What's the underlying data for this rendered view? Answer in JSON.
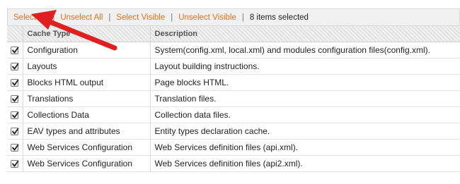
{
  "massaction": {
    "select_all": "Select All",
    "unselect_all": "Unselect All",
    "select_visible": "Select Visible",
    "unselect_visible": "Unselect Visible",
    "separator": "|",
    "selected_count": "8 items selected"
  },
  "grid": {
    "headers": {
      "cache_type": "Cache Type",
      "description": "Description"
    },
    "rows": [
      {
        "cache_type": "Configuration",
        "description": "System(config.xml, local.xml) and modules configuration files(config.xml).",
        "checked": true
      },
      {
        "cache_type": "Layouts",
        "description": "Layout building instructions.",
        "checked": true
      },
      {
        "cache_type": "Blocks HTML output",
        "description": "Page blocks HTML.",
        "checked": true
      },
      {
        "cache_type": "Translations",
        "description": "Translation files.",
        "checked": true
      },
      {
        "cache_type": "Collections Data",
        "description": "Collection data files.",
        "checked": true
      },
      {
        "cache_type": "EAV types and attributes",
        "description": "Entity types declaration cache.",
        "checked": true
      },
      {
        "cache_type": "Web Services Configuration",
        "description": "Web Services definition files (api.xml).",
        "checked": true
      },
      {
        "cache_type": "Web Services Configuration",
        "description": "Web Services definition files (api2.xml).",
        "checked": true
      }
    ]
  },
  "annotation": {
    "arrow_color": "#e02020",
    "link_color": "#e26e19"
  }
}
